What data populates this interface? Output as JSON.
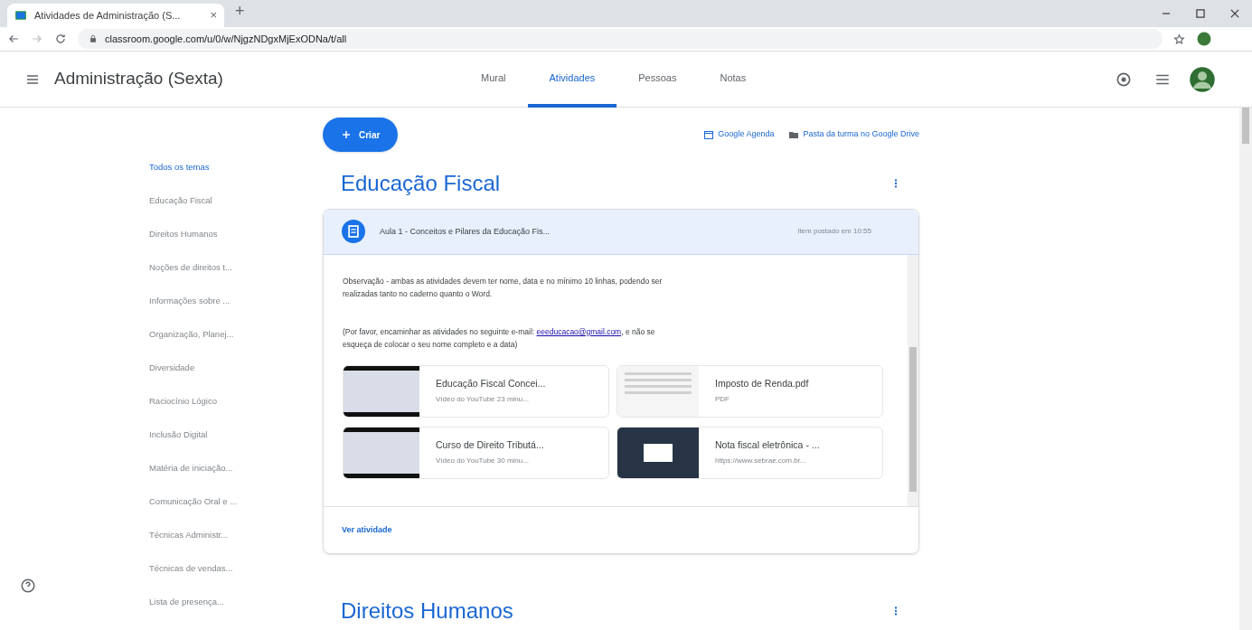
{
  "browser": {
    "tab_title": "Atividades de Administração (S...",
    "tab_close": "×",
    "new_tab": "+",
    "url": "classroom.google.com/u/0/w/NjgzNDgxMjExODNa/t/all"
  },
  "header": {
    "title": "Administração (Sexta)",
    "tabs": [
      {
        "label": "Mural",
        "selected": false
      },
      {
        "label": "Atividades",
        "selected": true
      },
      {
        "label": "Pessoas",
        "selected": false
      },
      {
        "label": "Notas",
        "selected": false
      }
    ]
  },
  "create_button": "Criar",
  "links": [
    {
      "kind": "calendar",
      "label": "Google Agenda"
    },
    {
      "kind": "drive",
      "label": "Pasta da turma no Google Drive"
    }
  ],
  "topics_nav": [
    {
      "label": "Todos os temas",
      "selected": true
    },
    {
      "label": "Educação Fiscal",
      "selected": false
    },
    {
      "label": "Direitos Humanos",
      "selected": false
    },
    {
      "label": "Noções de direitos t...",
      "selected": false
    },
    {
      "label": "Informações sobre ...",
      "selected": false
    },
    {
      "label": "Organização, Planej...",
      "selected": false
    },
    {
      "label": "Diversidade",
      "selected": false
    },
    {
      "label": "Raciocínio Lógico",
      "selected": false
    },
    {
      "label": "Inclusão Digital",
      "selected": false
    },
    {
      "label": "Matéria de iniciação...",
      "selected": false
    },
    {
      "label": "Comunicação Oral e ...",
      "selected": false
    },
    {
      "label": "Técnicas Administr...",
      "selected": false
    },
    {
      "label": "Técnicas de vendas...",
      "selected": false
    },
    {
      "label": "Lista de presença...",
      "selected": false
    }
  ],
  "topics": [
    {
      "title": "Educação Fiscal",
      "post": {
        "title": "Aula 1 - Conceitos e Pilares da Educação Fis...",
        "time": "Item postado em 10:55",
        "paragraphs": [
          {
            "text": "Observação - ambas as atividades devem ter nome, data e no mínimo 10 linhas, podendo ser realizadas tanto no caderno quanto o Word."
          },
          {
            "text": "(Por favor, encaminhar as atividades no seguinte e-mail:",
            "link": "eeeducacao@gmail.com",
            "text_after": ", e não se esqueça de colocar o seu nome completo e a data)"
          }
        ],
        "attachments": [
          {
            "kind": "video",
            "title": "Educação Fiscal Concei...",
            "subtitle": "Vídeo do YouTube  23 minu..."
          },
          {
            "kind": "pdf",
            "title": "Imposto de Renda.pdf",
            "subtitle": "PDF"
          },
          {
            "kind": "video",
            "title": "Curso de Direito Tributá...",
            "subtitle": "Vídeo do YouTube  30 minu..."
          },
          {
            "kind": "link",
            "title": "Nota fiscal eletrônica - ...",
            "subtitle": "https://www.sebrae.com.br..."
          }
        ],
        "view_link": "Ver atividade"
      }
    },
    {
      "title": "Direitos Humanos"
    }
  ]
}
